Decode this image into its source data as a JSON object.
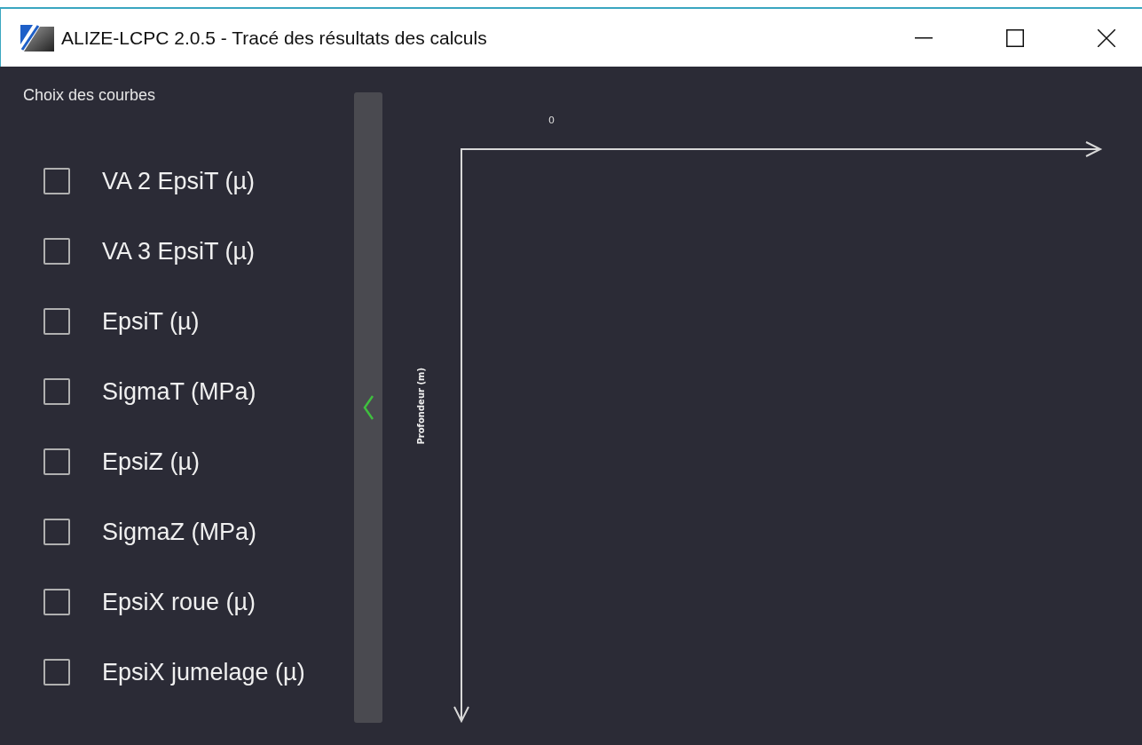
{
  "window": {
    "title": "ALIZE-LCPC 2.0.5 - Tracé des résultats des calculs"
  },
  "panel": {
    "title": "Choix des courbes",
    "curves": [
      {
        "label": "VA 2 EpsiT (µ)",
        "checked": false
      },
      {
        "label": "VA 3 EpsiT (µ)",
        "checked": false
      },
      {
        "label": "EpsiT (µ)",
        "checked": false
      },
      {
        "label": "SigmaT (MPa)",
        "checked": false
      },
      {
        "label": "EpsiZ (µ)",
        "checked": false
      },
      {
        "label": "SigmaZ (MPa)",
        "checked": false
      },
      {
        "label": "EpsiX roue (µ)",
        "checked": false
      },
      {
        "label": "EpsiX jumelage (µ)",
        "checked": false
      }
    ]
  },
  "plot": {
    "origin_label": "0",
    "y_axis_title": "Profondeur (m)"
  }
}
